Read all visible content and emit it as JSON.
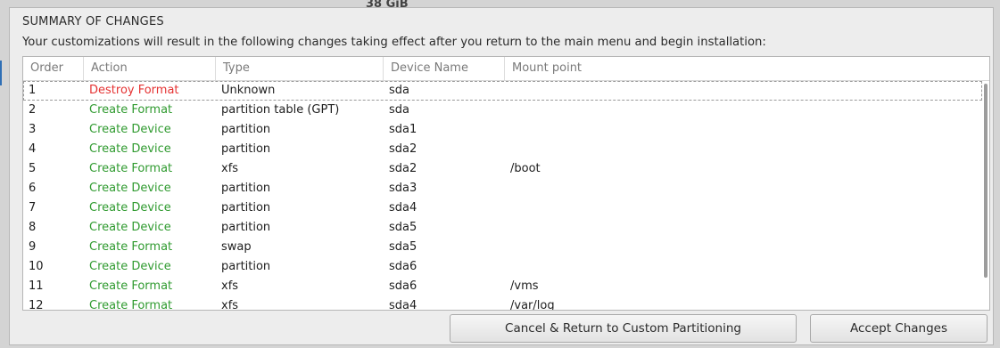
{
  "background": {
    "peek_text": "38 GiB"
  },
  "dialog": {
    "title": "SUMMARY OF CHANGES",
    "subtitle": "Your customizations will result in the following changes taking effect after you return to the main menu and begin installation:"
  },
  "table": {
    "columns": {
      "order": "Order",
      "action": "Action",
      "type": "Type",
      "device": "Device Name",
      "mount": "Mount point"
    },
    "rows": [
      {
        "order": "1",
        "action": "Destroy Format",
        "kind": "destroy",
        "type": "Unknown",
        "device": "sda",
        "mount": ""
      },
      {
        "order": "2",
        "action": "Create Format",
        "kind": "create",
        "type": "partition table (GPT)",
        "device": "sda",
        "mount": ""
      },
      {
        "order": "3",
        "action": "Create Device",
        "kind": "create",
        "type": "partition",
        "device": "sda1",
        "mount": ""
      },
      {
        "order": "4",
        "action": "Create Device",
        "kind": "create",
        "type": "partition",
        "device": "sda2",
        "mount": ""
      },
      {
        "order": "5",
        "action": "Create Format",
        "kind": "create",
        "type": "xfs",
        "device": "sda2",
        "mount": "/boot"
      },
      {
        "order": "6",
        "action": "Create Device",
        "kind": "create",
        "type": "partition",
        "device": "sda3",
        "mount": ""
      },
      {
        "order": "7",
        "action": "Create Device",
        "kind": "create",
        "type": "partition",
        "device": "sda4",
        "mount": ""
      },
      {
        "order": "8",
        "action": "Create Device",
        "kind": "create",
        "type": "partition",
        "device": "sda5",
        "mount": ""
      },
      {
        "order": "9",
        "action": "Create Format",
        "kind": "create",
        "type": "swap",
        "device": "sda5",
        "mount": ""
      },
      {
        "order": "10",
        "action": "Create Device",
        "kind": "create",
        "type": "partition",
        "device": "sda6",
        "mount": ""
      },
      {
        "order": "11",
        "action": "Create Format",
        "kind": "create",
        "type": "xfs",
        "device": "sda6",
        "mount": "/vms"
      },
      {
        "order": "12",
        "action": "Create Format",
        "kind": "create",
        "type": "xfs",
        "device": "sda4",
        "mount": "/var/log"
      }
    ]
  },
  "buttons": {
    "cancel": "Cancel & Return to Custom Partitioning",
    "accept": "Accept Changes"
  },
  "colors": {
    "destroy": "#e53333",
    "create": "#2f9a2f"
  }
}
